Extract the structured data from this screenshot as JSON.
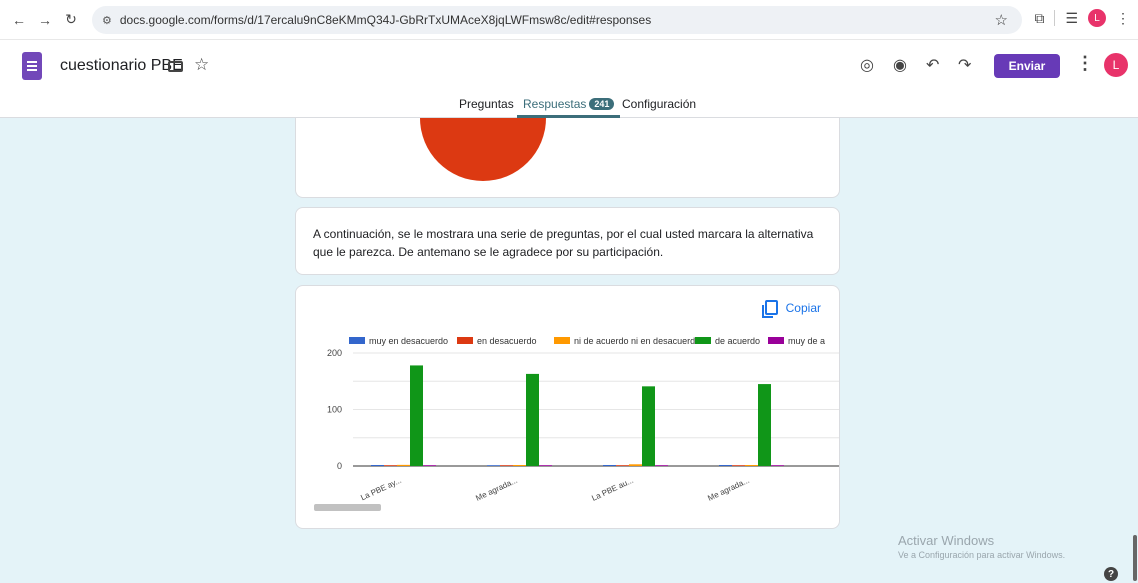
{
  "browser": {
    "url": "docs.google.com/forms/d/17ercalu9nC8eKMmQ34J-GbRrTxUMAceX8jqLWFmsw8c/edit#responses",
    "avatar_letter": "L"
  },
  "header": {
    "title": "cuestionario PBE",
    "send_label": "Enviar",
    "avatar_letter": "L"
  },
  "tabs": [
    {
      "label": "Preguntas",
      "active": false
    },
    {
      "label": "Respuestas",
      "active": true,
      "badge": "241"
    },
    {
      "label": "Configuración",
      "active": false
    }
  ],
  "section": {
    "description": "A continuación, se le mostrara una serie de preguntas, por el cual usted marcara la alternativa que le parezca. De antemano se le agradece por su participación."
  },
  "chart_card": {
    "copy_label": "Copiar"
  },
  "chart_data": {
    "type": "bar",
    "categories": [
      "La PBE ay...",
      "Me agrada...",
      "La PBE au...",
      "Me agrada..."
    ],
    "series": [
      {
        "name": "muy en desacuerdo",
        "color": "#3366cc",
        "values": [
          1,
          0,
          1,
          1
        ]
      },
      {
        "name": "en desacuerdo",
        "color": "#dc3912",
        "values": [
          0,
          0,
          0,
          0
        ]
      },
      {
        "name": "ni de acuerdo ni en desacuerdo",
        "color": "#ff9900",
        "values": [
          2,
          1,
          3,
          1
        ]
      },
      {
        "name": "de acuerdo",
        "color": "#109618",
        "values": [
          178,
          163,
          141,
          145
        ]
      },
      {
        "name": "muy de a",
        "color": "#990099",
        "values": [
          0,
          0,
          0,
          0
        ]
      }
    ],
    "yticks": [
      0,
      100,
      200
    ],
    "ylim": [
      0,
      200
    ],
    "grid": true,
    "legend": "top"
  },
  "watermark": {
    "title": "Activar Windows",
    "subtitle": "Ve a Configuración para activar Windows."
  }
}
